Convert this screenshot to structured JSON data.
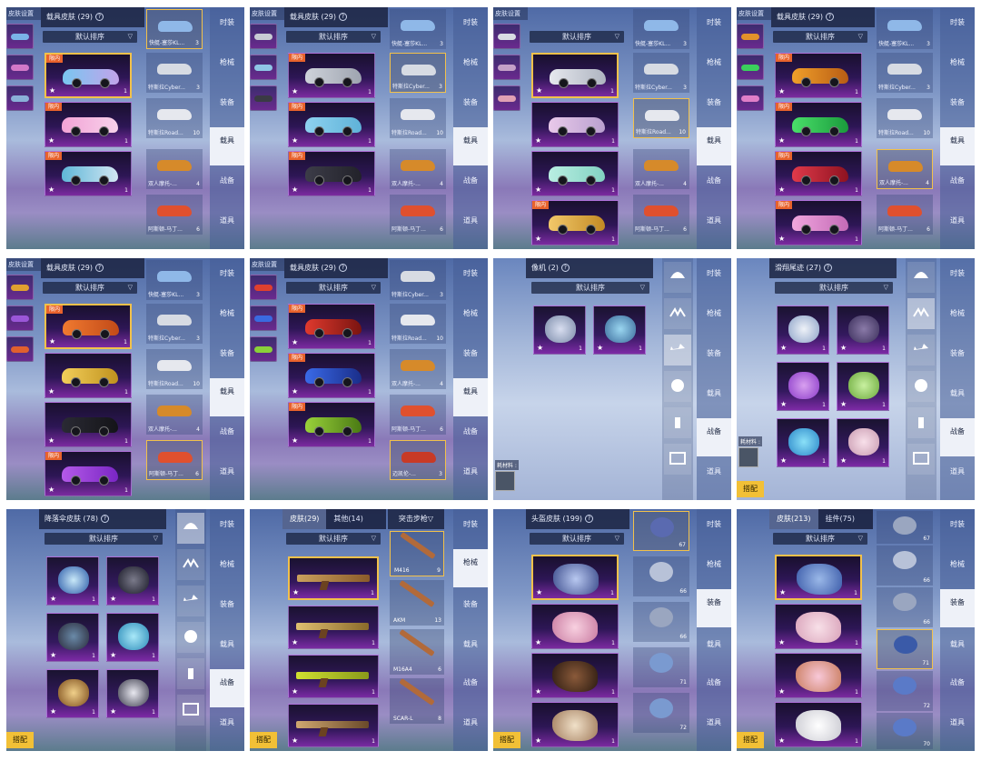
{
  "common": {
    "star": "★",
    "check": "✓",
    "help": "?",
    "chevron": "▽",
    "sort_label": "默认排序",
    "tag_limited": "限内",
    "match_button": "搭配",
    "material_label": "耗材料 :"
  },
  "nav_tabs": [
    "时装",
    "枪械",
    "装备",
    "载具",
    "战备",
    "道具"
  ],
  "vehicle_right_list": [
    {
      "label": "快艇-塞莎KL...",
      "count": "3"
    },
    {
      "label": "特斯拉Cyber...",
      "count": "3"
    },
    {
      "label": "特斯拉Road...",
      "count": "10"
    },
    {
      "label": "双人摩托-...",
      "count": "4"
    },
    {
      "label": "阿斯顿-马丁...",
      "count": "6"
    }
  ],
  "vehicle_right_list_alt": [
    {
      "label": "特斯拉Cyber...",
      "count": "3"
    },
    {
      "label": "特斯拉Road...",
      "count": "10"
    },
    {
      "label": "双人摩托-...",
      "count": "4"
    },
    {
      "label": "阿斯顿-马丁...",
      "count": "6"
    },
    {
      "label": "迈凯伦-...",
      "count": "3"
    }
  ],
  "panels": {
    "p1": {
      "left_title": "皮肤设置",
      "title": "载具皮肤 (29)",
      "counts": [
        "1",
        "1",
        "1"
      ]
    },
    "p2": {
      "left_title": "皮肤设置",
      "title": "载具皮肤 (29)",
      "counts": [
        "1",
        "1",
        "1"
      ]
    },
    "p3": {
      "left_title": "皮肤设置",
      "counts": [
        "1",
        "1",
        "1",
        "1"
      ]
    },
    "p4": {
      "left_title": "皮肤设置",
      "title": "载具皮肤 (29)",
      "counts": [
        "1",
        "1",
        "1",
        "1"
      ]
    },
    "p5": {
      "left_title": "皮肤设置",
      "title": "载具皮肤 (29)",
      "counts": [
        "1",
        "1",
        "1",
        "1"
      ]
    },
    "p6": {
      "left_title": "皮肤设置",
      "title": "载具皮肤 (29)",
      "counts": [
        "1",
        "1",
        "1"
      ]
    },
    "p7": {
      "title": "像机 (2)",
      "counts": [
        "1",
        "1"
      ]
    },
    "p8": {
      "title": "滑翔尾迹 (27)",
      "counts": [
        "1",
        "1",
        "1",
        "1",
        "1",
        "1"
      ]
    },
    "p9": {
      "title": "降落伞皮肤 (78)",
      "counts": [
        "1",
        "1",
        "1",
        "1",
        "1",
        "1"
      ]
    },
    "p10": {
      "tab_skin": "皮肤(29)",
      "tab_other": "其他(14)",
      "category": "突击步枪",
      "counts": [
        "1",
        "1",
        "1",
        "1"
      ],
      "guns": [
        {
          "label": "M416",
          "count": "9"
        },
        {
          "label": "AKM",
          "count": "13"
        },
        {
          "label": "M16A4",
          "count": "6"
        },
        {
          "label": "SCAR-L",
          "count": "8"
        }
      ]
    },
    "p11": {
      "title": "头盔皮肤 (199)",
      "counts": [
        "1",
        "1",
        "1",
        "1"
      ],
      "right_counts": [
        "67",
        "66",
        "66",
        "71",
        "72"
      ]
    },
    "p12": {
      "tab_skin": "皮肤(213)",
      "tab_other": "挂件(75)",
      "counts": [
        "1",
        "1",
        "1",
        "1"
      ],
      "right_counts": [
        "67",
        "66",
        "66",
        "71",
        "72",
        "70"
      ]
    }
  },
  "colors": {
    "selected_border": "#f2c14a",
    "tag_bg": "#e8622c",
    "match_bg": "#f2c036",
    "nav_selected_bg": "#eef1f8"
  }
}
